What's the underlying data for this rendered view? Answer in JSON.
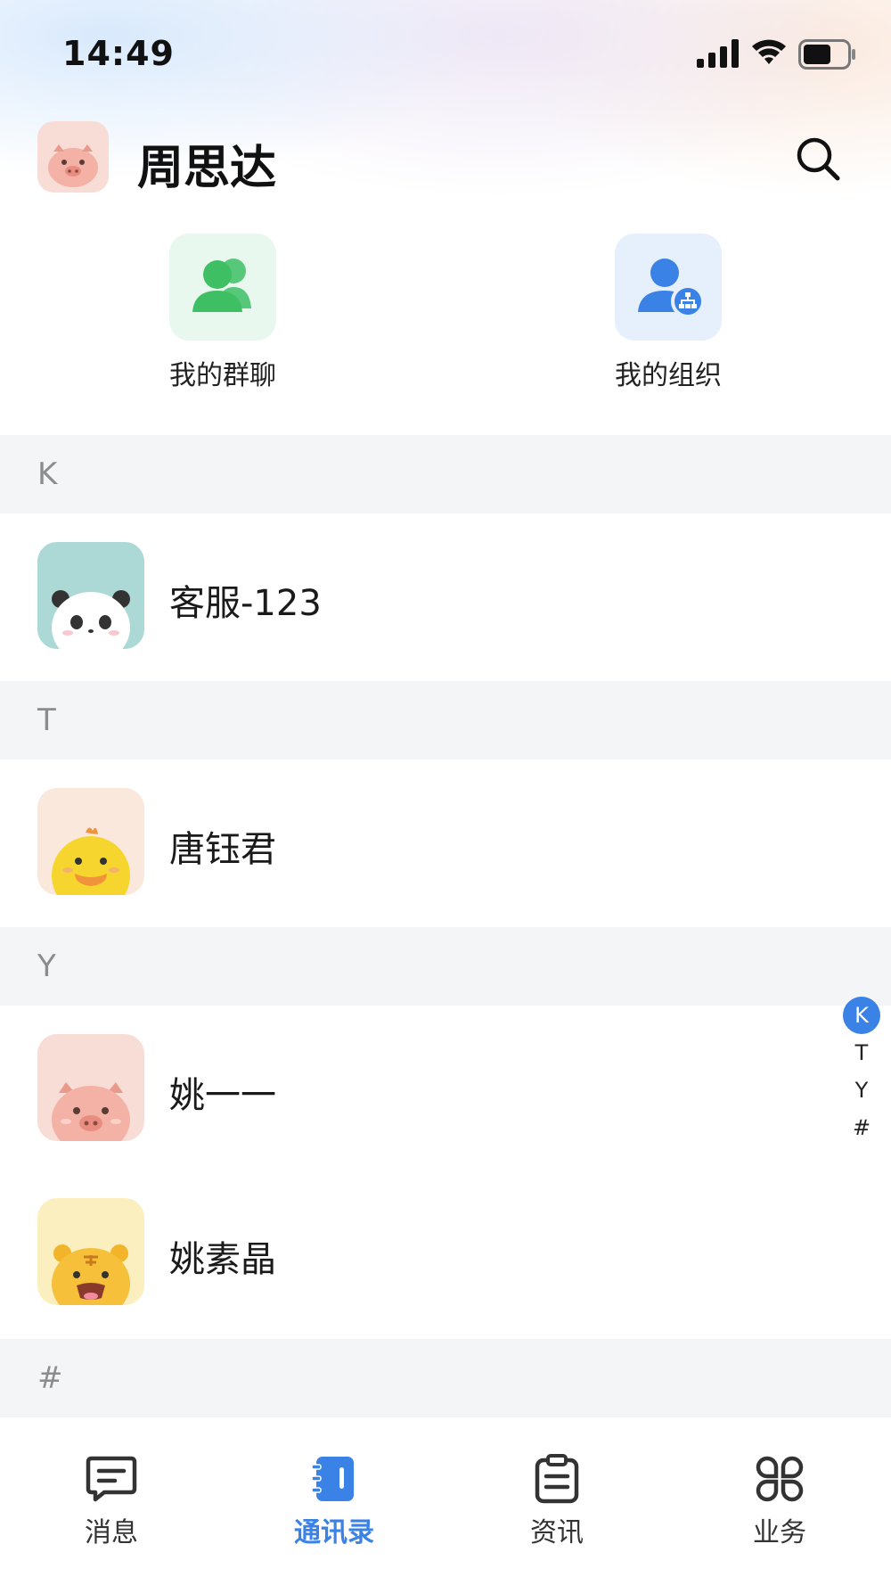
{
  "status_bar": {
    "time": "14:49"
  },
  "header": {
    "title": "周思达"
  },
  "shortcuts": [
    {
      "label": "我的群聊",
      "icon": "group-chat-icon",
      "color": "#4cc96a"
    },
    {
      "label": "我的组织",
      "icon": "organization-icon",
      "color": "#3b82e6"
    }
  ],
  "sections": [
    {
      "letter": "K",
      "contacts": [
        {
          "name": "客服-123",
          "avatar": "panda-avatar"
        }
      ]
    },
    {
      "letter": "T",
      "contacts": [
        {
          "name": "唐钰君",
          "avatar": "chick-avatar"
        }
      ]
    },
    {
      "letter": "Y",
      "contacts": [
        {
          "name": "姚一一",
          "avatar": "pig-avatar"
        },
        {
          "name": "姚素晶",
          "avatar": "tiger-avatar"
        }
      ]
    },
    {
      "letter": "#",
      "contacts": []
    }
  ],
  "index_bar": [
    "K",
    "T",
    "Y",
    "#"
  ],
  "tabs": [
    {
      "label": "消息",
      "icon": "message-icon",
      "active": false
    },
    {
      "label": "通讯录",
      "icon": "contacts-book-icon",
      "active": true
    },
    {
      "label": "资讯",
      "icon": "clipboard-icon",
      "active": false
    },
    {
      "label": "业务",
      "icon": "grid-apps-icon",
      "active": false
    }
  ],
  "colors": {
    "accent": "#3b82e6",
    "green": "#4cc96a",
    "section_bg": "#f4f5f7"
  }
}
